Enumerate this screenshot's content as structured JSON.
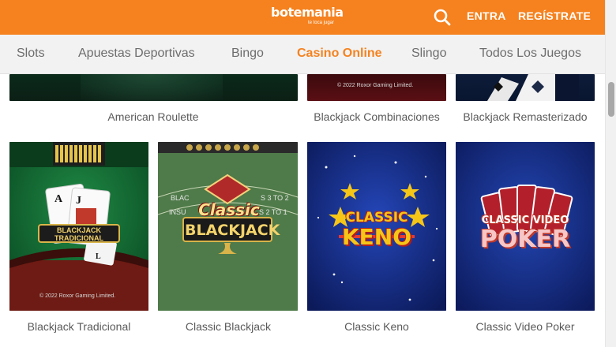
{
  "header": {
    "brand_name": "botemania",
    "brand_tagline": "te toca jugar",
    "search_icon": "search-icon",
    "login_label": "ENTRA",
    "register_label": "REGÍSTRATE",
    "colors": {
      "bar": "#f5821f",
      "text": "#ffffff"
    }
  },
  "nav": {
    "items": [
      {
        "label": "Slots"
      },
      {
        "label": "Apuestas Deportivas"
      },
      {
        "label": "Bingo"
      },
      {
        "label": "Casino Online",
        "active": true
      },
      {
        "label": "Slingo"
      },
      {
        "label": "Todos Los Juegos"
      }
    ],
    "colors": {
      "active": "#f5821f",
      "inactive": "#6d6d6d"
    }
  },
  "games_row1": [
    {
      "title": "American Roulette"
    },
    {
      "title": "Blackjack Combinaciones",
      "copyright": "© 2022 Roxor Gaming Limited."
    },
    {
      "title": "Blackjack Remasterizado"
    }
  ],
  "games_row2": [
    {
      "title": "Blackjack Tradicional",
      "art_label": "BLACKJACK TRADICIONAL",
      "copyright": "© 2022 Roxor Gaming Limited."
    },
    {
      "title": "Classic Blackjack",
      "art_line1": "Classic",
      "art_line2": "BLACKJACK",
      "table_text_left": "BLAC",
      "table_text_left2": "INSU",
      "table_text_right": "S 3 TO 2",
      "table_text_right2": "S 2 TO 1"
    },
    {
      "title": "Classic Keno",
      "art_line1": "CLASSIC",
      "art_line2": "KENO"
    },
    {
      "title": "Classic Video Poker",
      "art_line1": "CLASSIC VIDEO",
      "art_line2": "POKER"
    }
  ]
}
